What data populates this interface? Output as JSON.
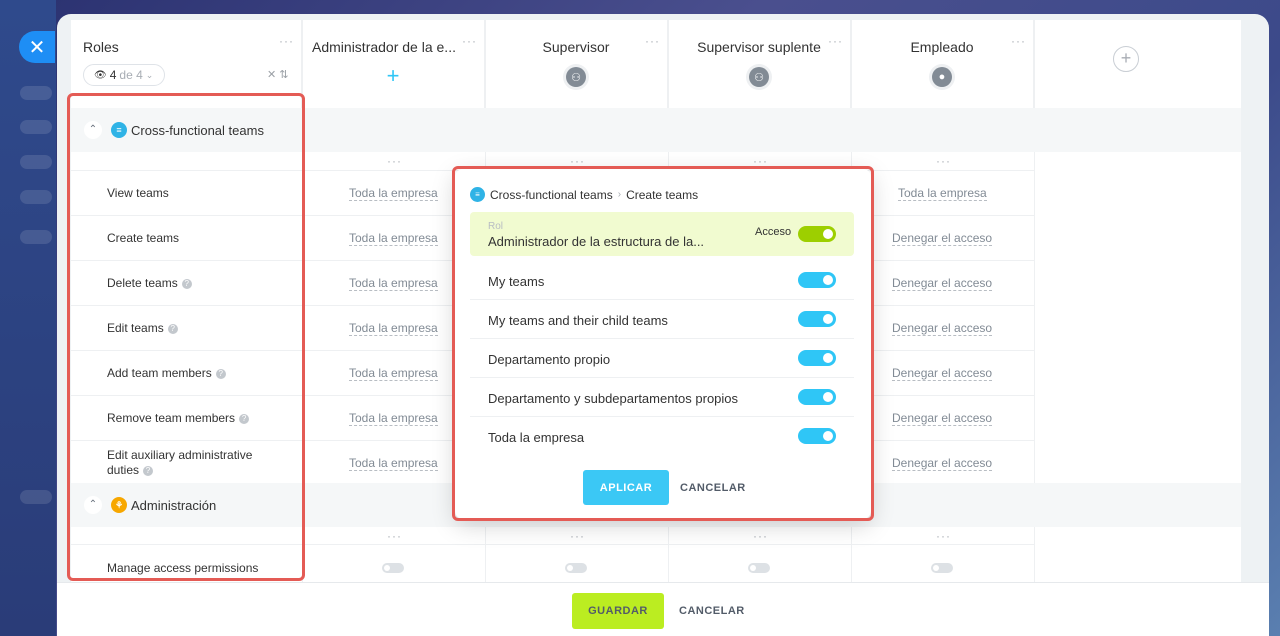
{
  "header": {
    "roles_title": "Roles",
    "count_current": "4",
    "count_of": "de 4",
    "columns": [
      {
        "title": "Administrador de la e..."
      },
      {
        "title": "Supervisor"
      },
      {
        "title": "Supervisor suplente"
      },
      {
        "title": "Empleado"
      }
    ],
    "dots": "···"
  },
  "sections": [
    {
      "label": "Cross-functional teams"
    },
    {
      "label": "Administración"
    }
  ],
  "rows": [
    {
      "label": "View teams",
      "cells": [
        "Toda la empresa",
        "Toda la empresa"
      ]
    },
    {
      "label": "Create teams",
      "cells": [
        "Toda la empresa",
        "Denegar el acceso"
      ]
    },
    {
      "label": "Delete teams",
      "cells": [
        "Toda la empresa",
        "Denegar el acceso"
      ]
    },
    {
      "label": "Edit teams",
      "cells": [
        "Toda la empresa",
        "Denegar el acceso"
      ]
    },
    {
      "label": "Add team members",
      "cells": [
        "Toda la empresa",
        "Denegar el acceso"
      ]
    },
    {
      "label": "Remove team members",
      "cells": [
        "Toda la empresa",
        "Denegar el acceso"
      ]
    },
    {
      "label_line1": "Edit auxiliary administrative",
      "label_line2": "duties",
      "cells": [
        "Toda la empresa",
        "Denegar el acceso"
      ]
    },
    {
      "label": "Manage access permissions"
    }
  ],
  "popup": {
    "crumb_section": "Cross-functional teams",
    "crumb_page": "Create teams",
    "role_small": "Rol",
    "role_name": "Administrador de la estructura de la...",
    "access_label": "Acceso",
    "options": [
      {
        "label": "My teams"
      },
      {
        "label": "My teams and their child teams"
      },
      {
        "label": "Departamento propio"
      },
      {
        "label": "Departamento y subdepartamentos propios"
      },
      {
        "label": "Toda la empresa"
      }
    ],
    "apply": "APLICAR",
    "cancel": "CANCELAR"
  },
  "footer": {
    "save": "GUARDAR",
    "cancel": "CANCELAR"
  },
  "colors": {
    "accent_blue": "#2fc6f6",
    "save_green": "#bbed21",
    "highlight_red": "#e45b55"
  }
}
